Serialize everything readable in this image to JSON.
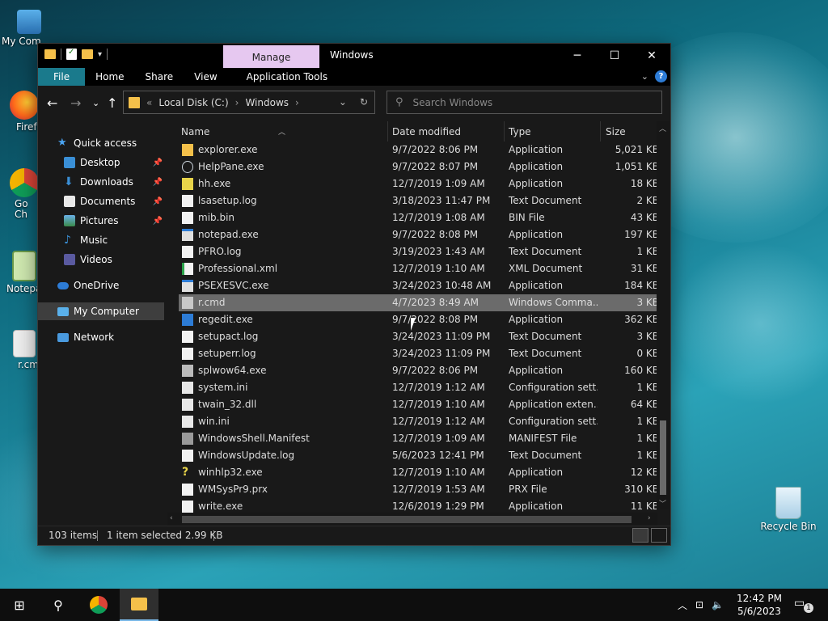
{
  "desktop": {
    "icons": [
      {
        "label": "My Com",
        "icon": "computer-icon"
      },
      {
        "label": "Firefo",
        "icon": "firefox-icon"
      },
      {
        "label": "Goog Chro",
        "icon": "chrome-icon"
      },
      {
        "label": "Notepa",
        "icon": "notepad-icon"
      },
      {
        "label": "r.cm",
        "icon": "cmd-file-icon"
      }
    ],
    "recycle_bin": {
      "label": "Recycle Bin",
      "icon": "recycle-bin-icon"
    }
  },
  "window": {
    "title": "Windows",
    "context_tab": "Manage",
    "ribbon_tabs": [
      "File",
      "Home",
      "Share",
      "View",
      "Application Tools"
    ],
    "caption": {
      "minimize": "─",
      "maximize": "☐",
      "close": "✕"
    }
  },
  "address": {
    "prefix": "«",
    "crumbs": [
      "Local Disk (C:)",
      "Windows"
    ],
    "separator": "›"
  },
  "search": {
    "placeholder": "Search Windows"
  },
  "nav_pane": {
    "items": [
      {
        "label": "Quick access",
        "icon": "star-icon",
        "pinned": false
      },
      {
        "label": "Desktop",
        "icon": "desktop-folder-icon",
        "pinned": true
      },
      {
        "label": "Downloads",
        "icon": "downloads-folder-icon",
        "pinned": true
      },
      {
        "label": "Documents",
        "icon": "documents-folder-icon",
        "pinned": true
      },
      {
        "label": "Pictures",
        "icon": "pictures-folder-icon",
        "pinned": true
      },
      {
        "label": "Music",
        "icon": "music-folder-icon",
        "pinned": false
      },
      {
        "label": "Videos",
        "icon": "videos-folder-icon",
        "pinned": false
      },
      {
        "label": "OneDrive",
        "icon": "cloud-icon",
        "pinned": false
      },
      {
        "label": "My Computer",
        "icon": "computer-icon",
        "pinned": false
      },
      {
        "label": "Network",
        "icon": "network-icon",
        "pinned": false
      }
    ]
  },
  "columns": [
    "Name",
    "Date modified",
    "Type",
    "Size"
  ],
  "files": [
    {
      "name": "explorer.exe",
      "date": "9/7/2022 8:06 PM",
      "type": "Application",
      "size": "5,021 KB",
      "icon": "explorer-icon"
    },
    {
      "name": "HelpPane.exe",
      "date": "9/7/2022 8:07 PM",
      "type": "Application",
      "size": "1,051 KB",
      "icon": "help-icon"
    },
    {
      "name": "hh.exe",
      "date": "12/7/2019 1:09 AM",
      "type": "Application",
      "size": "18 KB",
      "icon": "help-book-icon"
    },
    {
      "name": "lsasetup.log",
      "date": "3/18/2023 11:47 PM",
      "type": "Text Document",
      "size": "2 KB",
      "icon": "text-file-icon"
    },
    {
      "name": "mib.bin",
      "date": "12/7/2019 1:08 AM",
      "type": "BIN File",
      "size": "43 KB",
      "icon": "generic-file-icon"
    },
    {
      "name": "notepad.exe",
      "date": "9/7/2022 8:08 PM",
      "type": "Application",
      "size": "197 KB",
      "icon": "app-icon"
    },
    {
      "name": "PFRO.log",
      "date": "3/19/2023 1:43 AM",
      "type": "Text Document",
      "size": "1 KB",
      "icon": "text-file-icon"
    },
    {
      "name": "Professional.xml",
      "date": "12/7/2019 1:10 AM",
      "type": "XML Document",
      "size": "31 KB",
      "icon": "xml-file-icon"
    },
    {
      "name": "PSEXESVC.exe",
      "date": "3/24/2023 10:48 AM",
      "type": "Application",
      "size": "184 KB",
      "icon": "app-icon"
    },
    {
      "name": "r.cmd",
      "date": "4/7/2023 8:49 AM",
      "type": "Windows Comma...",
      "size": "3 KB",
      "icon": "cmd-file-icon",
      "selected": true
    },
    {
      "name": "regedit.exe",
      "date": "9/7/2022 8:08 PM",
      "type": "Application",
      "size": "362 KB",
      "icon": "regedit-icon"
    },
    {
      "name": "setupact.log",
      "date": "3/24/2023 11:09 PM",
      "type": "Text Document",
      "size": "3 KB",
      "icon": "text-file-icon"
    },
    {
      "name": "setuperr.log",
      "date": "3/24/2023 11:09 PM",
      "type": "Text Document",
      "size": "0 KB",
      "icon": "text-file-icon"
    },
    {
      "name": "splwow64.exe",
      "date": "9/7/2022 8:06 PM",
      "type": "Application",
      "size": "160 KB",
      "icon": "printer-icon"
    },
    {
      "name": "system.ini",
      "date": "12/7/2019 1:12 AM",
      "type": "Configuration sett...",
      "size": "1 KB",
      "icon": "config-file-icon"
    },
    {
      "name": "twain_32.dll",
      "date": "12/7/2019 1:10 AM",
      "type": "Application exten...",
      "size": "64 KB",
      "icon": "dll-file-icon"
    },
    {
      "name": "win.ini",
      "date": "12/7/2019 1:12 AM",
      "type": "Configuration sett...",
      "size": "1 KB",
      "icon": "config-file-icon"
    },
    {
      "name": "WindowsShell.Manifest",
      "date": "12/7/2019 1:09 AM",
      "type": "MANIFEST File",
      "size": "1 KB",
      "icon": "manifest-file-icon"
    },
    {
      "name": "WindowsUpdate.log",
      "date": "5/6/2023 12:41 PM",
      "type": "Text Document",
      "size": "1 KB",
      "icon": "text-file-icon"
    },
    {
      "name": "winhlp32.exe",
      "date": "12/7/2019 1:10 AM",
      "type": "Application",
      "size": "12 KB",
      "icon": "help-question-icon"
    },
    {
      "name": "WMSysPr9.prx",
      "date": "12/7/2019 1:53 AM",
      "type": "PRX File",
      "size": "310 KB",
      "icon": "generic-file-icon"
    },
    {
      "name": "write.exe",
      "date": "12/6/2019 1:29 PM",
      "type": "Application",
      "size": "11 KB",
      "icon": "write-icon"
    }
  ],
  "status": {
    "items": "103 items",
    "selected": "1 item selected  2.99 KB"
  },
  "taskbar": {
    "start": "⊞",
    "search_icon": "⚲",
    "time": "12:42 PM",
    "date": "5/6/2023",
    "notification_count": "1"
  },
  "colors": {
    "accent": "#1a7a8c",
    "manage_tab": "#e6c8f0",
    "selected_row": "#6b6b6b",
    "folder": "#f4c04a"
  }
}
